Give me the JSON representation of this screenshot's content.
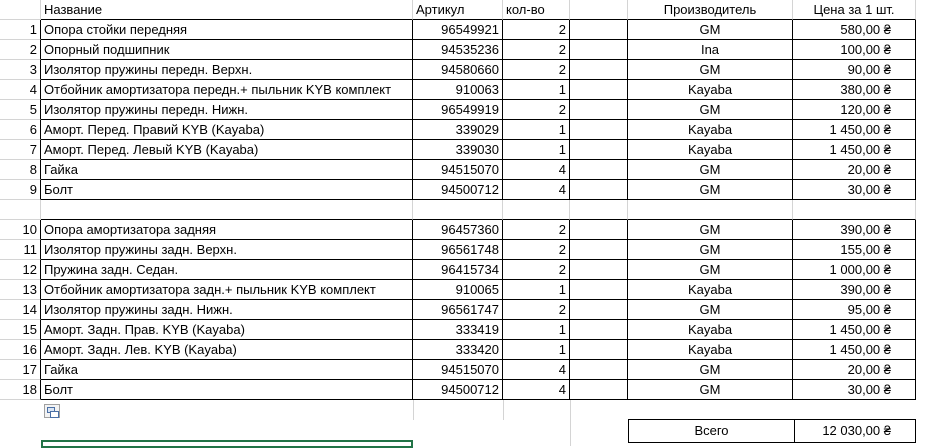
{
  "headers": {
    "name": "Название",
    "article": "Артикул",
    "qty": "кол-во",
    "manufacturer": "Производитель",
    "price": "Цена за 1 шт."
  },
  "group1": [
    {
      "no": "1",
      "name": "Опора стойки передняя",
      "article": "96549921",
      "qty": "2",
      "manufacturer": "GM",
      "price": "580,00 ₴"
    },
    {
      "no": "2",
      "name": "Опорный подшипник",
      "article": "94535236",
      "qty": "2",
      "manufacturer": "Ina",
      "price": "100,00 ₴"
    },
    {
      "no": "3",
      "name": "Изолятор пружины передн. Верхн.",
      "article": "94580660",
      "qty": "2",
      "manufacturer": "GM",
      "price": "90,00 ₴"
    },
    {
      "no": "4",
      "name": "Отбойник амортизатора передн.+ пыльник KYB комплект",
      "article": "910063",
      "qty": "1",
      "manufacturer": "Kayaba",
      "price": "380,00 ₴"
    },
    {
      "no": "5",
      "name": "Изолятор пружины передн. Нижн.",
      "article": "96549919",
      "qty": "2",
      "manufacturer": "GM",
      "price": "120,00 ₴"
    },
    {
      "no": "6",
      "name": "Аморт. Перед. Правий KYB (Kayaba)",
      "article": "339029",
      "qty": "1",
      "manufacturer": "Kayaba",
      "price": "1 450,00 ₴"
    },
    {
      "no": "7",
      "name": "Аморт. Перед. Левый KYB (Kayaba)",
      "article": "339030",
      "qty": "1",
      "manufacturer": "Kayaba",
      "price": "1 450,00 ₴"
    },
    {
      "no": "8",
      "name": "Гайка",
      "article": "94515070",
      "qty": "4",
      "manufacturer": "GM",
      "price": "20,00 ₴"
    },
    {
      "no": "9",
      "name": "Болт",
      "article": "94500712",
      "qty": "4",
      "manufacturer": "GM",
      "price": "30,00 ₴"
    }
  ],
  "group2": [
    {
      "no": "10",
      "name": "Опора амортизатора задняя",
      "article": "96457360",
      "qty": "2",
      "manufacturer": "GM",
      "price": "390,00 ₴"
    },
    {
      "no": "11",
      "name": "Изолятор пружины задн. Верхн.",
      "article": "96561748",
      "qty": "2",
      "manufacturer": "GM",
      "price": "155,00 ₴"
    },
    {
      "no": "12",
      "name": "Пружина задн. Седан.",
      "article": "96415734",
      "qty": "2",
      "manufacturer": "GM",
      "price": "1 000,00 ₴"
    },
    {
      "no": "13",
      "name": "Отбойник амортизатора задн.+ пыльник KYB комплект",
      "article": "910065",
      "qty": "1",
      "manufacturer": "Kayaba",
      "price": "390,00 ₴"
    },
    {
      "no": "14",
      "name": "Изолятор пружины задн. Нижн.",
      "article": "96561747",
      "qty": "2",
      "manufacturer": "GM",
      "price": "95,00 ₴"
    },
    {
      "no": "15",
      "name": "Аморт. Задн. Прав. KYB (Kayaba)",
      "article": "333419",
      "qty": "1",
      "manufacturer": "Kayaba",
      "price": "1 450,00 ₴"
    },
    {
      "no": "16",
      "name": "Аморт. Задн. Лев. KYB (Kayaba)",
      "article": "333420",
      "qty": "1",
      "manufacturer": "Kayaba",
      "price": "1 450,00 ₴"
    },
    {
      "no": "17",
      "name": "Гайка",
      "article": "94515070",
      "qty": "4",
      "manufacturer": "GM",
      "price": "20,00 ₴"
    },
    {
      "no": "18",
      "name": "Болт",
      "article": "94500712",
      "qty": "4",
      "manufacturer": "GM",
      "price": "30,00 ₴"
    }
  ],
  "total": {
    "label": "Всего",
    "value": "12 030,00 ₴"
  },
  "icons": {
    "paste_options": "paste-options-icon"
  },
  "colors": {
    "selection": "#217346",
    "gridline": "#d4d4d4"
  }
}
